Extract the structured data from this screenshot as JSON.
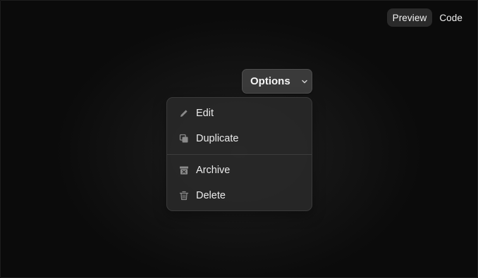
{
  "header": {
    "tabs": [
      {
        "label": "Preview",
        "active": true
      },
      {
        "label": "Code",
        "active": false
      }
    ]
  },
  "trigger": {
    "label": "Options",
    "icon": "chevron-down-icon"
  },
  "menu": {
    "groups": [
      [
        {
          "label": "Edit",
          "icon": "pencil-icon"
        },
        {
          "label": "Duplicate",
          "icon": "copy-icon"
        }
      ],
      [
        {
          "label": "Archive",
          "icon": "archive-icon"
        },
        {
          "label": "Delete",
          "icon": "trash-icon"
        }
      ]
    ]
  },
  "colors": {
    "background": "#0a0a0a",
    "menu_bg": "#282828",
    "button_bg": "#3a3a3a",
    "text": "#ececec",
    "icon": "#8a8a8a"
  }
}
